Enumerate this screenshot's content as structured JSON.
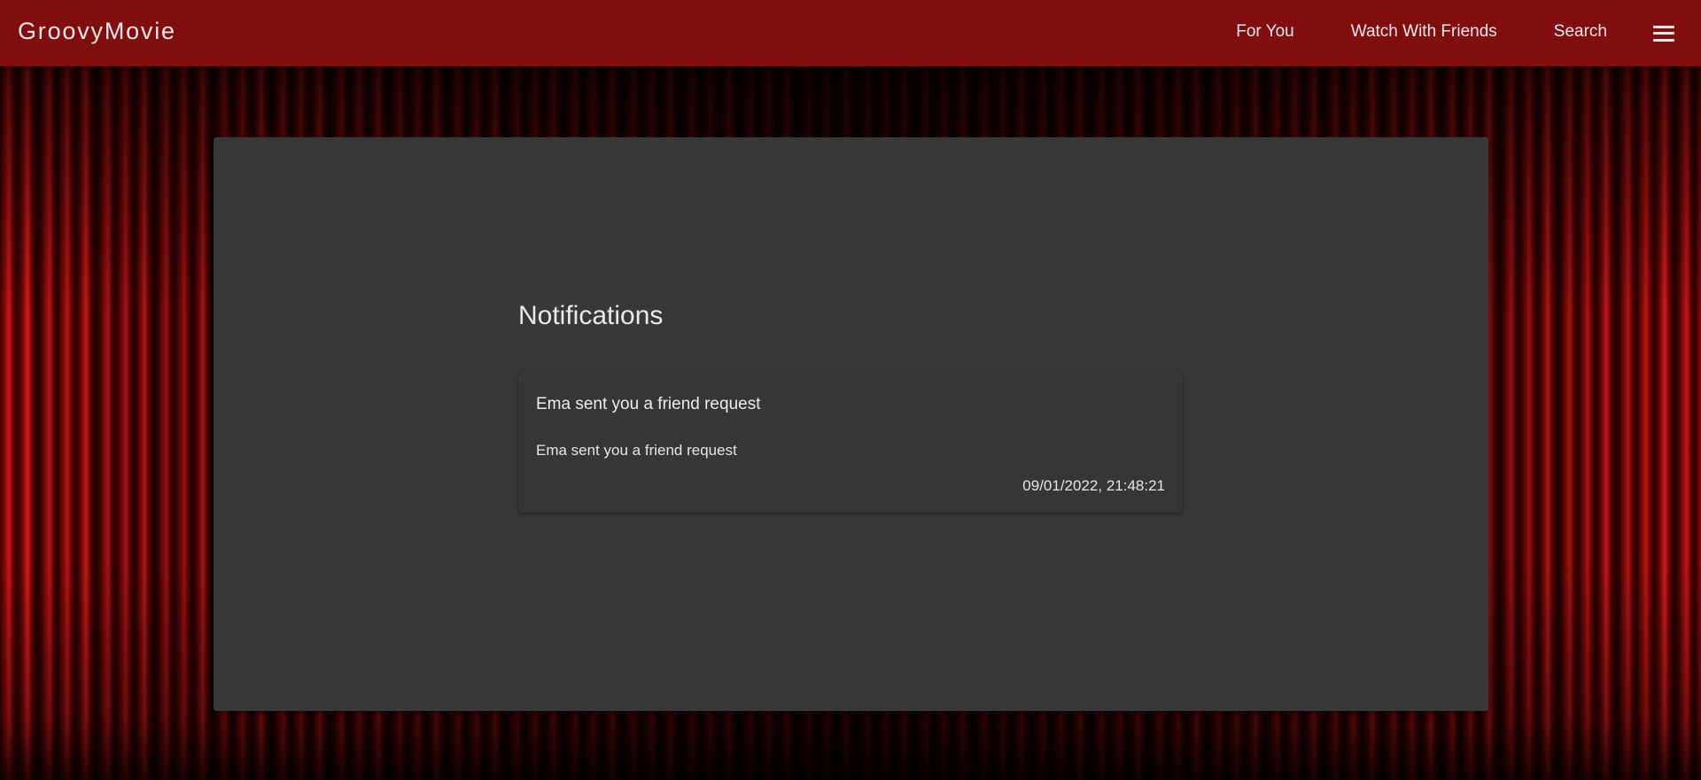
{
  "app": {
    "title": "GroovyMovie"
  },
  "nav": {
    "items": [
      {
        "label": "For You"
      },
      {
        "label": "Watch With Friends"
      },
      {
        "label": "Search"
      }
    ],
    "menu_icon": "menu-icon"
  },
  "main": {
    "title": "Notifications",
    "notifications": [
      {
        "title": "Ema sent you a friend request",
        "body": "Ema sent you a friend request",
        "timestamp": "09/01/2022, 21:48:21"
      }
    ]
  },
  "colors": {
    "appbar": "#800e0e",
    "panel": "#383838",
    "card": "#363636",
    "curtain_red": "#d01818"
  }
}
